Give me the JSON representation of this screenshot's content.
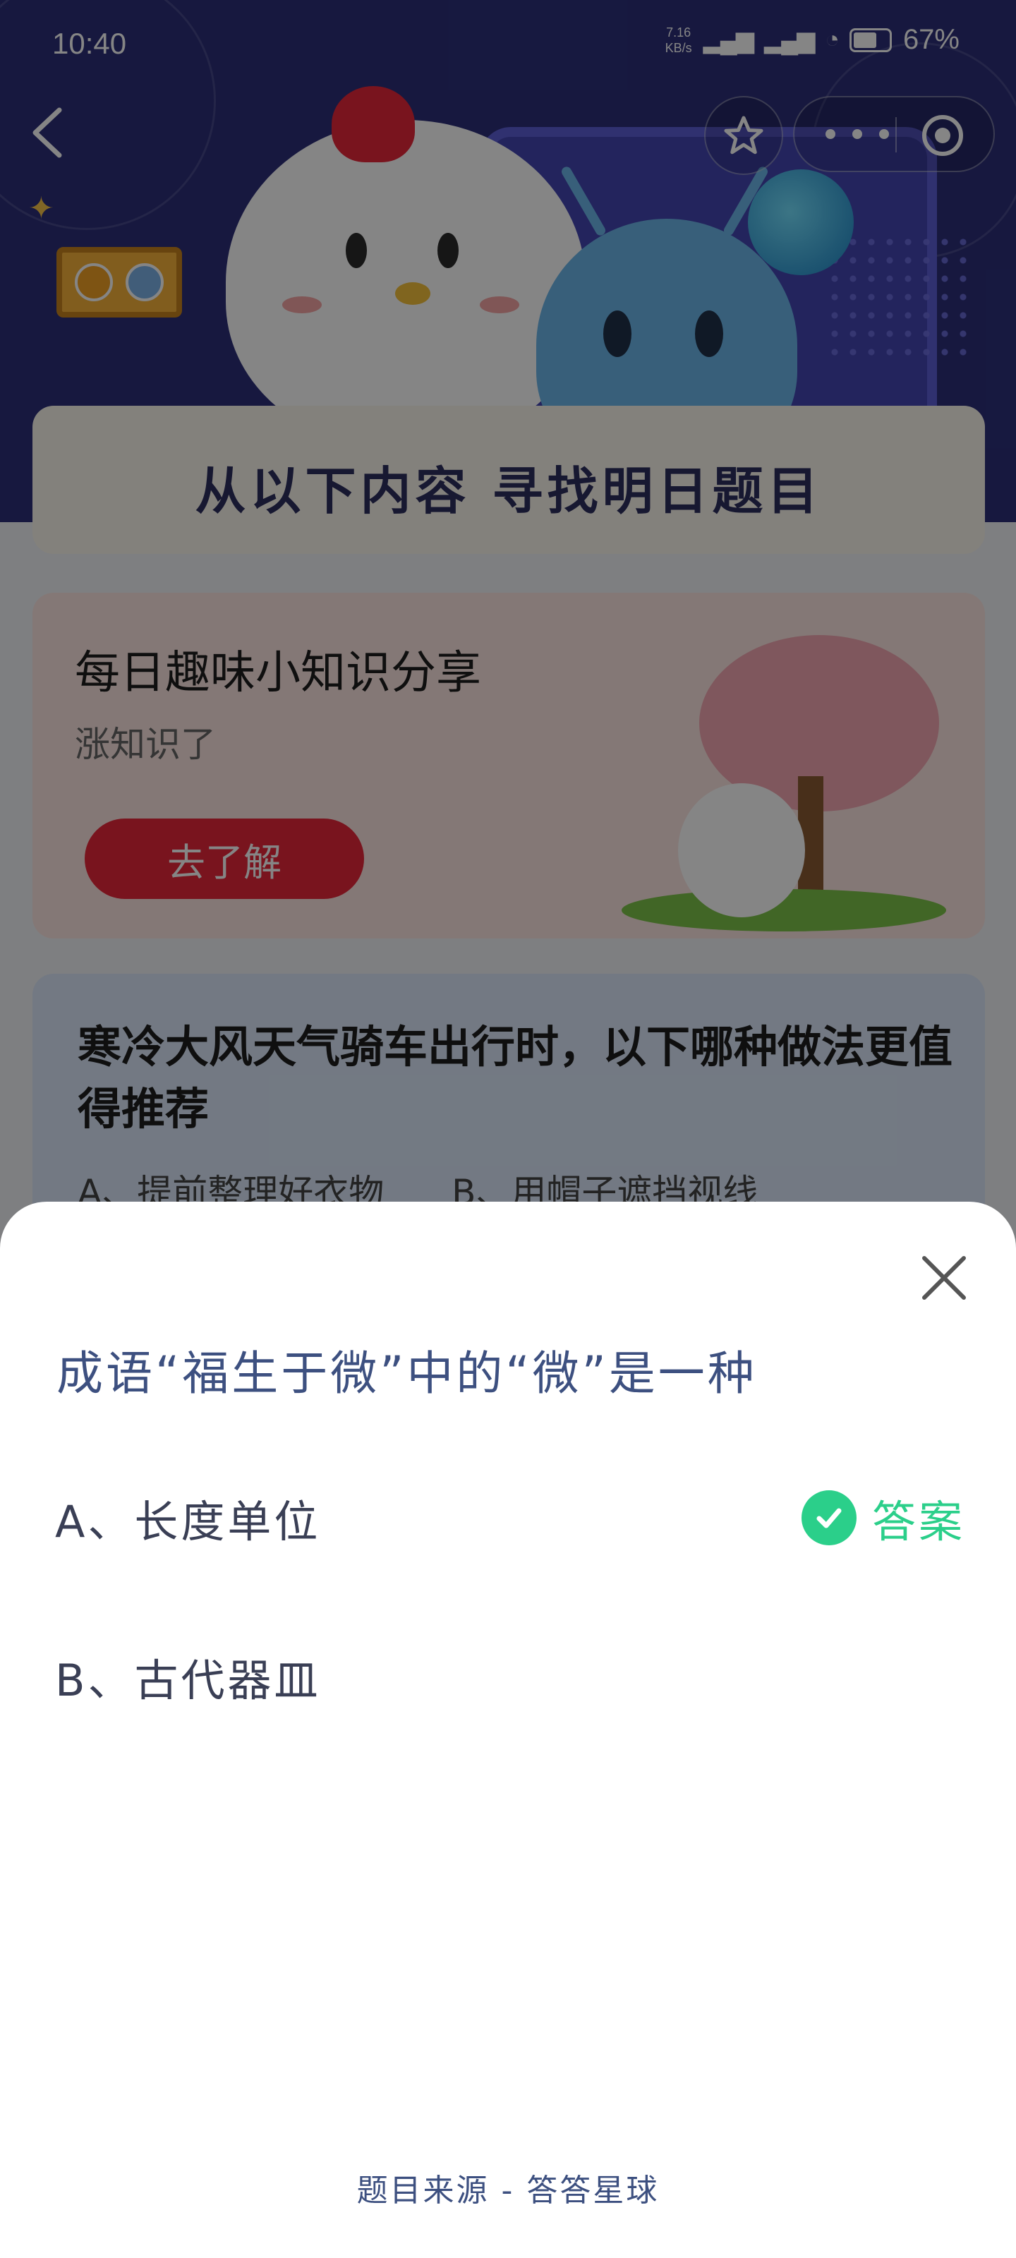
{
  "status_bar": {
    "time": "10:40",
    "net_speed_value": "7.16",
    "net_speed_unit": "KB/s",
    "battery": "67%"
  },
  "background_page": {
    "banner_title": "从以下内容  寻找明日题目",
    "knowledge_card": {
      "title": "每日趣味小知识分享",
      "subtitle": "涨知识了",
      "button": "去了解"
    },
    "quiz_card": {
      "question": "寒冷大风天气骑车出行时，以下哪种做法更值得推荐",
      "option_a": "A、提前整理好衣物",
      "option_b": "B、用帽子遮挡视线"
    }
  },
  "sheet": {
    "question": "成语“福生于微”中的“微”是一种",
    "options": [
      {
        "label": "A、长度单位",
        "is_answer": true
      },
      {
        "label": "B、古代器皿",
        "is_answer": false
      }
    ],
    "answer_label": "答案",
    "source": "题目来源 - 答答星球"
  },
  "colors": {
    "accent_green": "#2bcf8a",
    "question_blue": "#3d5080",
    "brand_red": "#e8283a"
  }
}
